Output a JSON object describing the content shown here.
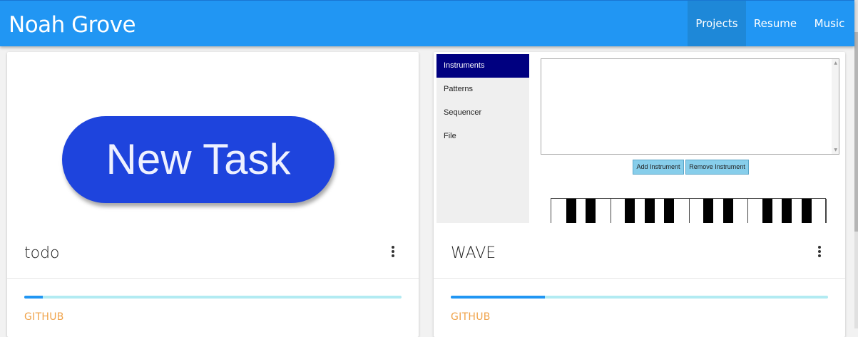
{
  "navbar": {
    "brand": "Noah Grove",
    "links": [
      {
        "label": "Projects",
        "active": true
      },
      {
        "label": "Resume",
        "active": false
      },
      {
        "label": "Music",
        "active": false
      }
    ],
    "color": "#2196f3"
  },
  "projects": [
    {
      "title": "todo",
      "preview_text": "New Task",
      "progress": 0.05,
      "link": "GITHUB"
    },
    {
      "title": "WAVE",
      "preview": {
        "sidebar": [
          "Instruments",
          "Patterns",
          "Sequencer",
          "File"
        ],
        "active": "Instruments",
        "buttons": [
          "Add Instrument",
          "Remove Instrument"
        ]
      },
      "progress": 0.25,
      "link": "GITHUB"
    }
  ],
  "colors": {
    "accent": "#2196f3",
    "progress_track": "#b2ebf2",
    "link": "#f0a34a",
    "pill": "#1e44dd"
  }
}
